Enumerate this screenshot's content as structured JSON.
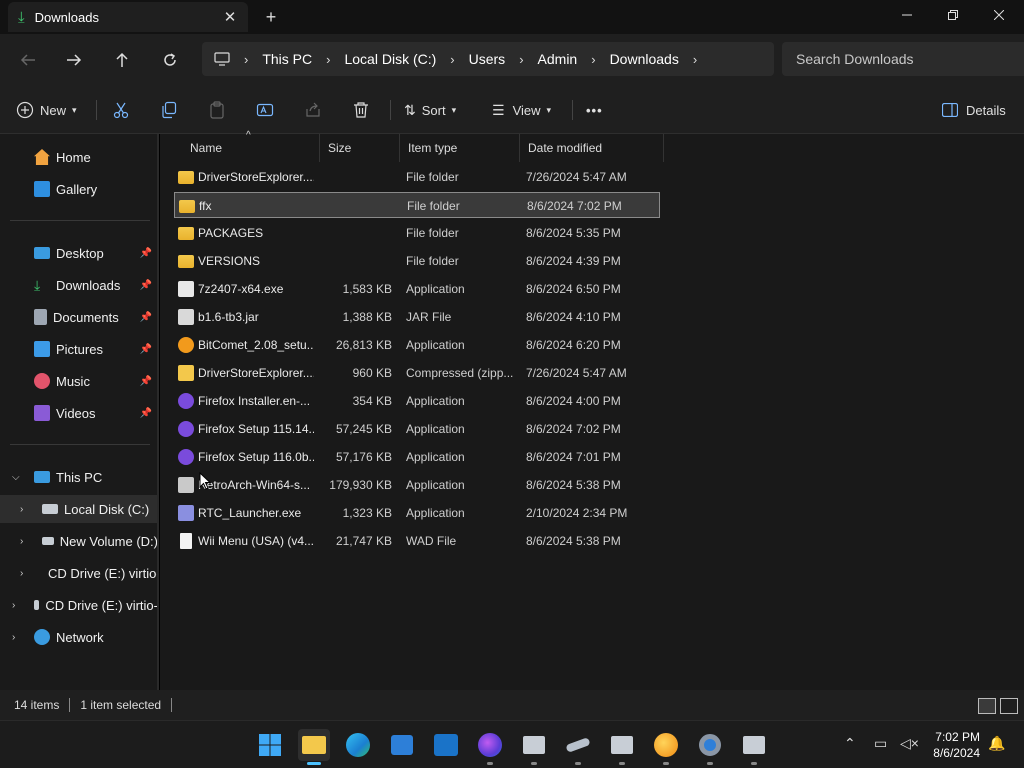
{
  "window": {
    "tab_title": "Downloads",
    "close_tab": "✕",
    "new_tab": "+"
  },
  "address": {
    "crumbs": [
      "This PC",
      "Local Disk (C:)",
      "Users",
      "Admin",
      "Downloads"
    ],
    "search_placeholder": "Search Downloads"
  },
  "commands": {
    "new": "New",
    "sort": "Sort",
    "view": "View",
    "more": "•••",
    "details": "Details"
  },
  "sidebar": {
    "home": "Home",
    "gallery": "Gallery",
    "desktop": "Desktop",
    "downloads": "Downloads",
    "documents": "Documents",
    "pictures": "Pictures",
    "music": "Music",
    "videos": "Videos",
    "this_pc": "This PC",
    "local_disk": "Local Disk (C:)",
    "new_volume": "New Volume (D:)",
    "cd_drive_1": "CD Drive (E:) virtio-",
    "cd_drive_2": "CD Drive (E:) virtio-",
    "network": "Network"
  },
  "columns": {
    "name": "Name",
    "size": "Size",
    "type": "Item type",
    "date": "Date modified"
  },
  "files": [
    {
      "name": "DriverStoreExplorer....",
      "size": "",
      "type": "File folder",
      "date": "7/26/2024 5:47 AM",
      "icon": "folder"
    },
    {
      "name": "ffx",
      "size": "",
      "type": "File folder",
      "date": "8/6/2024 7:02 PM",
      "icon": "folder",
      "selected": true
    },
    {
      "name": "PACKAGES",
      "size": "",
      "type": "File folder",
      "date": "8/6/2024 5:35 PM",
      "icon": "folder"
    },
    {
      "name": "VERSIONS",
      "size": "",
      "type": "File folder",
      "date": "8/6/2024 4:39 PM",
      "icon": "folder"
    },
    {
      "name": "7z2407-x64.exe",
      "size": "1,583 KB",
      "type": "Application",
      "date": "8/6/2024 6:50 PM",
      "icon": "7zip"
    },
    {
      "name": "b1.6-tb3.jar",
      "size": "1,388 KB",
      "type": "JAR File",
      "date": "8/6/2024 4:10 PM",
      "icon": "jar"
    },
    {
      "name": "BitComet_2.08_setu...",
      "size": "26,813 KB",
      "type": "Application",
      "date": "8/6/2024 6:20 PM",
      "icon": "bitcomet"
    },
    {
      "name": "DriverStoreExplorer....",
      "size": "960 KB",
      "type": "Compressed (zipp...",
      "date": "7/26/2024 5:47 AM",
      "icon": "zip"
    },
    {
      "name": "Firefox Installer.en-...",
      "size": "354 KB",
      "type": "Application",
      "date": "8/6/2024 4:00 PM",
      "icon": "firefox"
    },
    {
      "name": "Firefox Setup 115.14...",
      "size": "57,245 KB",
      "type": "Application",
      "date": "8/6/2024 7:02 PM",
      "icon": "firefox"
    },
    {
      "name": "Firefox Setup 116.0b...",
      "size": "57,176 KB",
      "type": "Application",
      "date": "8/6/2024 7:01 PM",
      "icon": "firefox"
    },
    {
      "name": "RetroArch-Win64-s...",
      "size": "179,930 KB",
      "type": "Application",
      "date": "8/6/2024 5:38 PM",
      "icon": "retroarch"
    },
    {
      "name": "RTC_Launcher.exe",
      "size": "1,323 KB",
      "type": "Application",
      "date": "2/10/2024 2:34 PM",
      "icon": "rtc"
    },
    {
      "name": "Wii Menu (USA) (v4...",
      "size": "21,747 KB",
      "type": "WAD File",
      "date": "8/6/2024 5:38 PM",
      "icon": "file"
    }
  ],
  "status": {
    "items": "14 items",
    "selected": "1 item selected"
  },
  "taskbar": {
    "time": "7:02 PM",
    "date": "8/6/2024"
  },
  "colors": {
    "folder": "#f3c84b",
    "accent": "#4cc2ff",
    "selection": "#3a3a3a"
  }
}
